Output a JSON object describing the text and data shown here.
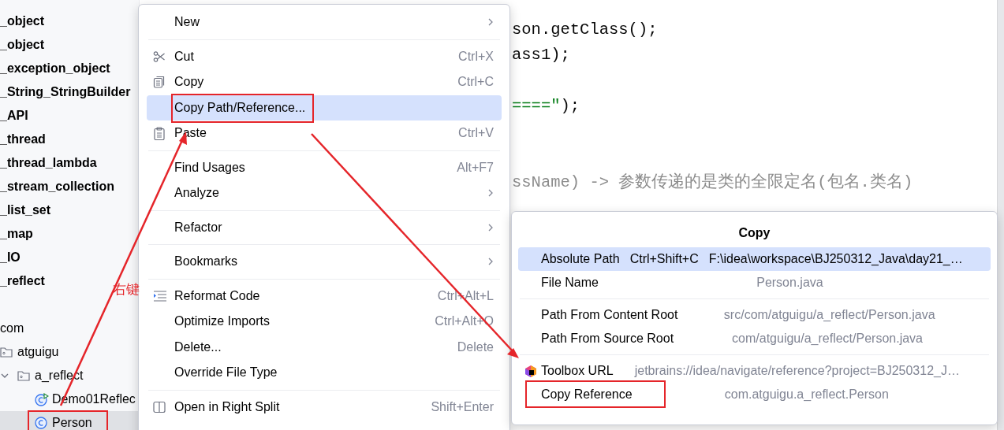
{
  "project_tree": {
    "modules": [
      {
        "label": "_object",
        "kind": "module",
        "selected": false
      },
      {
        "label": "_object",
        "kind": "module",
        "selected": false
      },
      {
        "label": "_exception_object",
        "kind": "module",
        "selected": false
      },
      {
        "label": "_String_StringBuilder",
        "kind": "module",
        "selected": false
      },
      {
        "label": "_API",
        "kind": "module",
        "selected": false
      },
      {
        "label": "_thread",
        "kind": "module",
        "selected": false
      },
      {
        "label": "_thread_lambda",
        "kind": "module",
        "selected": false
      },
      {
        "label": "_stream_collection",
        "kind": "module",
        "selected": false
      },
      {
        "label": "_list_set",
        "kind": "module",
        "selected": false
      },
      {
        "label": "_map",
        "kind": "module",
        "selected": false
      },
      {
        "label": "_IO",
        "kind": "module",
        "selected": false
      },
      {
        "label": "_reflect",
        "kind": "module",
        "selected": false
      }
    ],
    "packages": [
      {
        "label": "com",
        "kind": "package",
        "selected": false,
        "children": [
          {
            "label": "atguigu",
            "kind": "folder",
            "selected": false,
            "children": [
              {
                "label": "a_reflect",
                "kind": "folder",
                "selected": false,
                "expanded": true,
                "children": [
                  {
                    "label": "Demo01Reflec",
                    "kind": "main-class",
                    "selected": false
                  },
                  {
                    "label": "Person",
                    "kind": "class",
                    "selected": true
                  }
                ]
              }
            ]
          }
        ]
      }
    ]
  },
  "editor": {
    "blocks": [
      [
        {
          "segments": [
            {
              "text": "son.getClass();",
              "kind": "code"
            }
          ]
        },
        {
          "segments": [
            {
              "text": "ass1);",
              "kind": "code"
            }
          ]
        }
      ],
      [
        {
          "segments": [
            {
              "text": "====\"",
              "kind": "string"
            },
            {
              "text": ");",
              "kind": "code"
            }
          ]
        }
      ],
      [
        {
          "segments": [
            {
              "text": "ssName)  -> 参数传递的是类的全限定名(包名.类名)",
              "kind": "comment"
            }
          ]
        }
      ]
    ]
  },
  "context_menu": {
    "groups": [
      [
        {
          "label": "New",
          "kind": "plain",
          "submenu": true,
          "selected": false
        }
      ],
      [
        {
          "label": "Cut",
          "kind": "cut",
          "shortcut": "Ctrl+X",
          "submenu": false,
          "selected": false
        },
        {
          "label": "Copy",
          "kind": "copy",
          "shortcut": "Ctrl+C",
          "submenu": false,
          "selected": false
        },
        {
          "label": "Copy Path/Reference...",
          "kind": "plain",
          "submenu": false,
          "selected": true
        },
        {
          "label": "Paste",
          "kind": "paste",
          "shortcut": "Ctrl+V",
          "submenu": false,
          "selected": false
        }
      ],
      [
        {
          "label": "Find Usages",
          "kind": "plain",
          "shortcut": "Alt+F7",
          "submenu": false,
          "selected": false
        },
        {
          "label": "Analyze",
          "kind": "plain",
          "submenu": true,
          "selected": false
        }
      ],
      [
        {
          "label": "Refactor",
          "kind": "plain",
          "submenu": true,
          "selected": false
        }
      ],
      [
        {
          "label": "Bookmarks",
          "kind": "plain",
          "submenu": true,
          "selected": false
        }
      ],
      [
        {
          "label": "Reformat Code",
          "kind": "reformat",
          "shortcut": "Ctrl+Alt+L",
          "submenu": false,
          "selected": false
        },
        {
          "label": "Optimize Imports",
          "kind": "plain",
          "shortcut": "Ctrl+Alt+O",
          "submenu": false,
          "selected": false
        },
        {
          "label": "Delete...",
          "kind": "plain",
          "shortcut": "Delete",
          "submenu": false,
          "selected": false
        },
        {
          "label": "Override File Type",
          "kind": "plain",
          "submenu": false,
          "selected": false
        }
      ],
      [
        {
          "label": "Open in Right Split",
          "kind": "split",
          "shortcut": "Shift+Enter",
          "submenu": false,
          "selected": false
        }
      ]
    ]
  },
  "copy_popup": {
    "title": "Copy",
    "groups": [
      [
        {
          "label": "Absolute Path",
          "kind": "plain",
          "shortcut": "Ctrl+Shift+C",
          "value": "F:\\idea\\workspace\\BJ250312_Java\\day21_…",
          "selected": true
        },
        {
          "label": "File Name",
          "kind": "plain",
          "value": "Person.java",
          "selected": false
        }
      ],
      [
        {
          "label": "Path From Content Root",
          "kind": "plain",
          "value": "src/com/atguigu/a_reflect/Person.java",
          "selected": false
        },
        {
          "label": "Path From Source Root",
          "kind": "plain",
          "value": "com/atguigu/a_reflect/Person.java",
          "selected": false
        }
      ],
      [
        {
          "label": "Toolbox URL",
          "kind": "toolbox",
          "value": "jetbrains://idea/navigate/reference?project=BJ250312_J…",
          "selected": false
        },
        {
          "label": "Copy Reference",
          "kind": "plain",
          "value": "com.atguigu.a_reflect.Person",
          "selected": false
        }
      ]
    ]
  },
  "annotation": {
    "label": "右键"
  }
}
